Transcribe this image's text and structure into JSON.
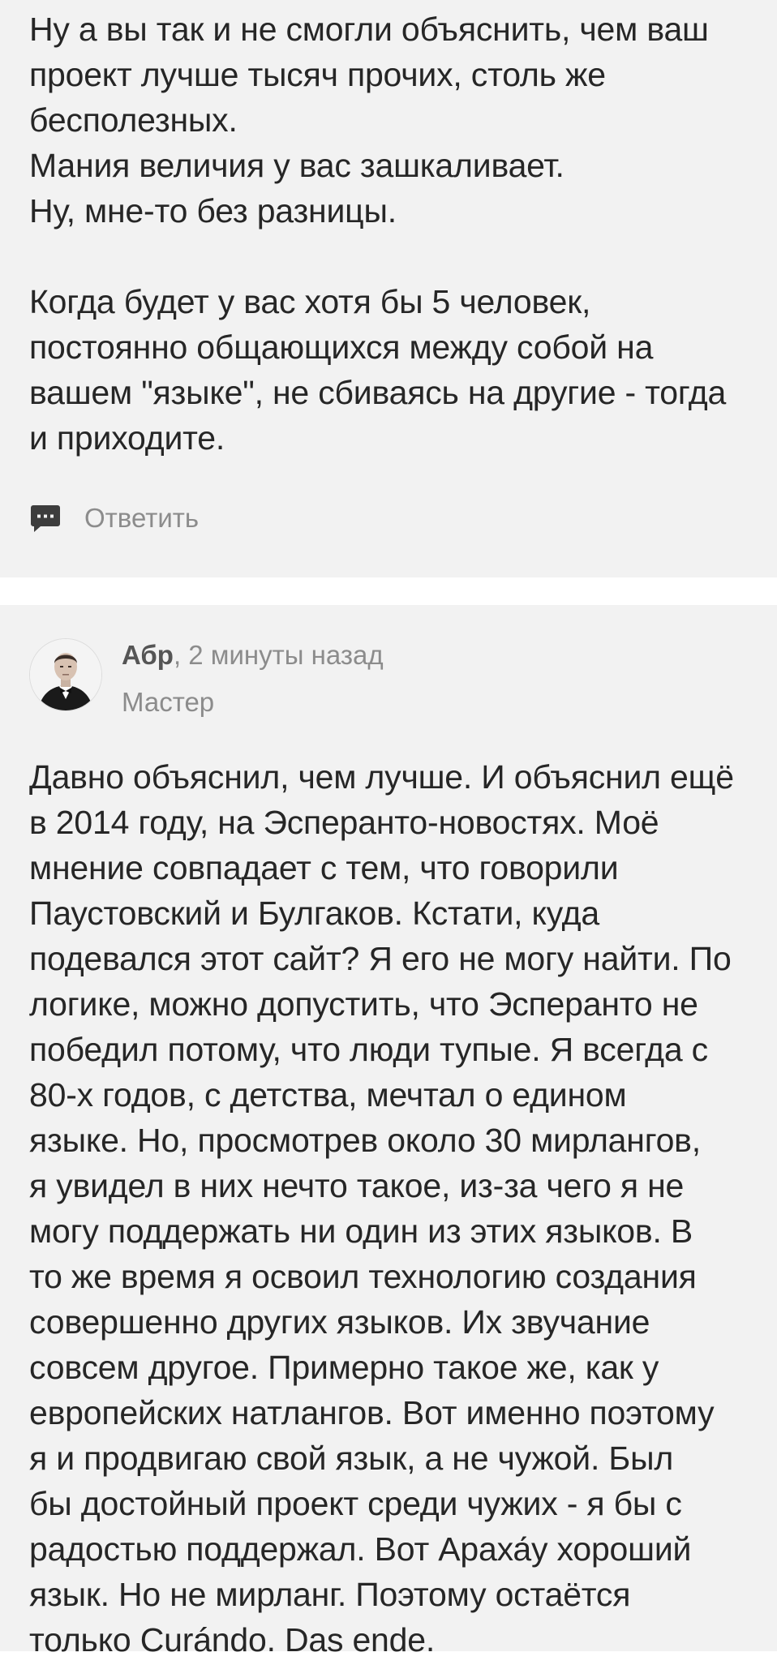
{
  "comments": [
    {
      "text": "Ну а вы так и не смогли объяснить, чем ваш\nпроект лучше тысяч прочих, столь же\nбесполезных.\nМания величия у вас зашкаливает.\nНу, мне-то без разницы.\n\nКогда будет у вас хотя бы 5 человек,\nпостоянно общающихся между собой на\nвашем \"языке\", не сбиваясь на другие - тогда\nи приходите.",
      "reply_label": "Ответить"
    },
    {
      "author": "Абр",
      "time": ", 2 минуты назад",
      "rank": "Мастер",
      "text": "Давно объяснил, чем лучше. И объяснил ещё\nв 2014 году, на Эсперанто-новостях. Моё\nмнение совпадает с тем, что говорили\nПаустовский и Булгаков. Кстати, куда\nподевался этот сайт? Я его не могу найти. По\nлогике, можно допустить, что Эсперанто не\nпобедил потому, что люди тупые. Я всегда с\n80-х годов, с детства, мечтал о едином\nязыке. Но, просмотрев около 30 мирлангов,\nя увидел в них нечто такое, из-за чего я не\nмогу поддержать ни один из этих языков. В\nто же время я освоил технологию создания\nсовершенно других языков. Их звучание\nсовсем другое. Примерно такое же, как у\nевропейских натлангов. Вот именно поэтому\nя и продвигаю свой язык, а не чужой. Был\nбы достойный проект среди чужих - я бы с\nрадостью поддержал. Вот Араха́у хороший\nязык. Но не мирланг. Поэтому остаётся\nтолько Curándo. Das ende."
    }
  ],
  "icons": {
    "reply": "comment-bubble-icon",
    "avatar": "user-avatar"
  },
  "colors": {
    "card_background": "#f2f2f2",
    "page_background": "#ffffff",
    "text": "#262626",
    "muted": "#8c8c8c",
    "icon": "#3d3d3d"
  }
}
